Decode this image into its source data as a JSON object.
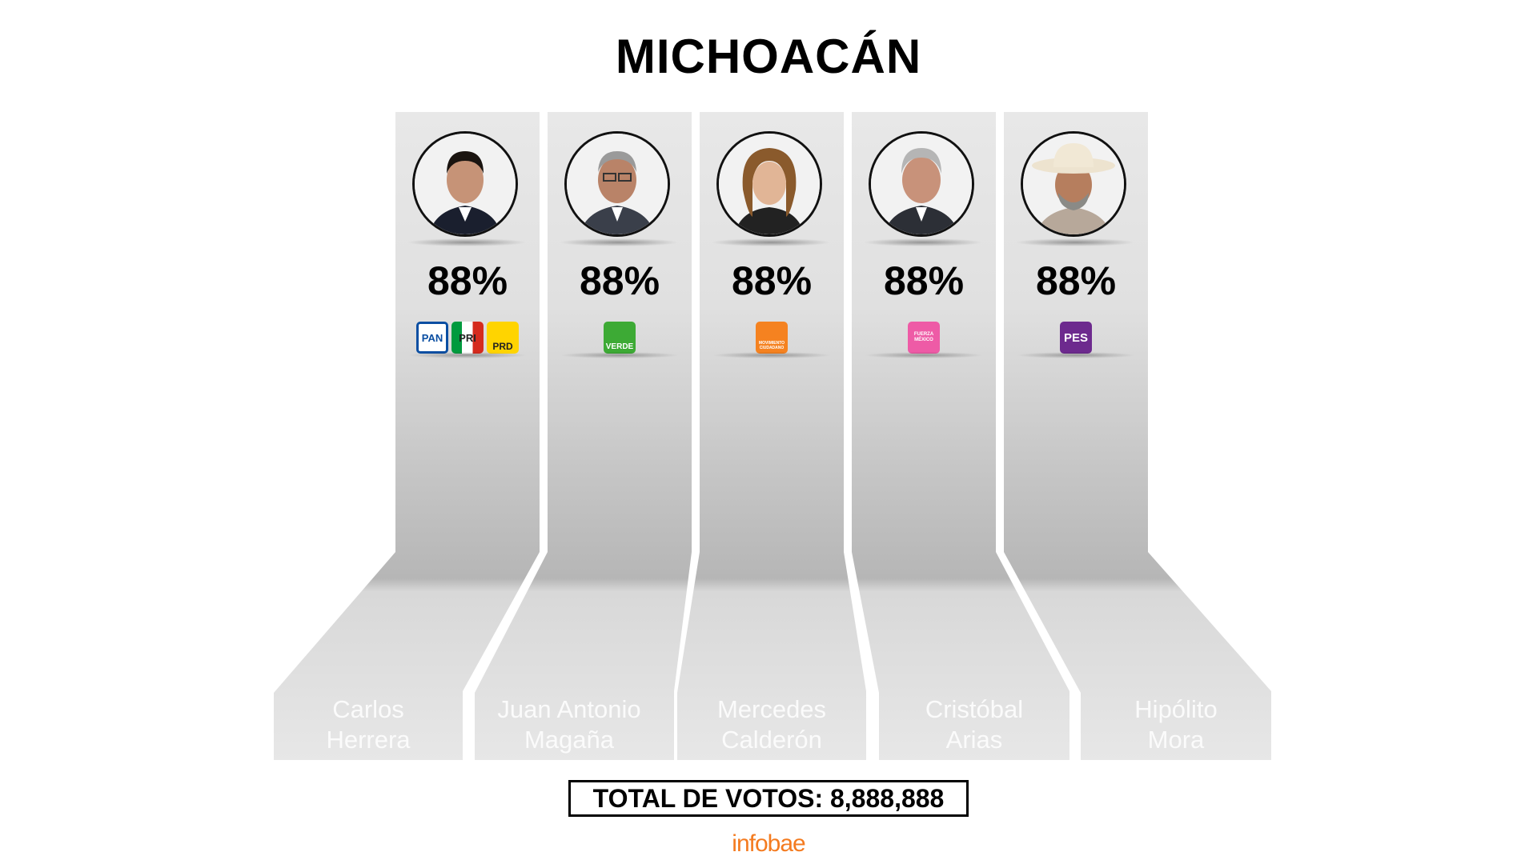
{
  "title": "MICHOACÁN",
  "candidates": [
    {
      "name_line1": "Carlos",
      "name_line2": "Herrera",
      "percent": "88%",
      "parties": [
        "PAN",
        "PRI",
        "PRD"
      ]
    },
    {
      "name_line1": "Juan Antonio",
      "name_line2": "Magaña",
      "percent": "88%",
      "parties": [
        "VERDE"
      ]
    },
    {
      "name_line1": "Mercedes",
      "name_line2": "Calderón",
      "percent": "88%",
      "parties": [
        "MOVIMIENTO CIUDADANO"
      ]
    },
    {
      "name_line1": "Cristóbal",
      "name_line2": "Arias",
      "percent": "88%",
      "parties": [
        "FUERZA MÉXICO"
      ]
    },
    {
      "name_line1": "Hipólito",
      "name_line2": "Mora",
      "percent": "88%",
      "parties": [
        "PES"
      ]
    }
  ],
  "total_votes": "TOTAL DE VOTOS: 8,888,888",
  "brand": "infobae",
  "colors": {
    "pan": "#0a4ea2",
    "pri_green": "#009a3e",
    "pri_red": "#d52b1e",
    "prd": "#ffd400",
    "verde": "#3daa35",
    "mc": "#f58220",
    "fuerza_mexico": "#ee5ba6",
    "pes": "#6d2a8e",
    "brand": "#f47b20"
  }
}
